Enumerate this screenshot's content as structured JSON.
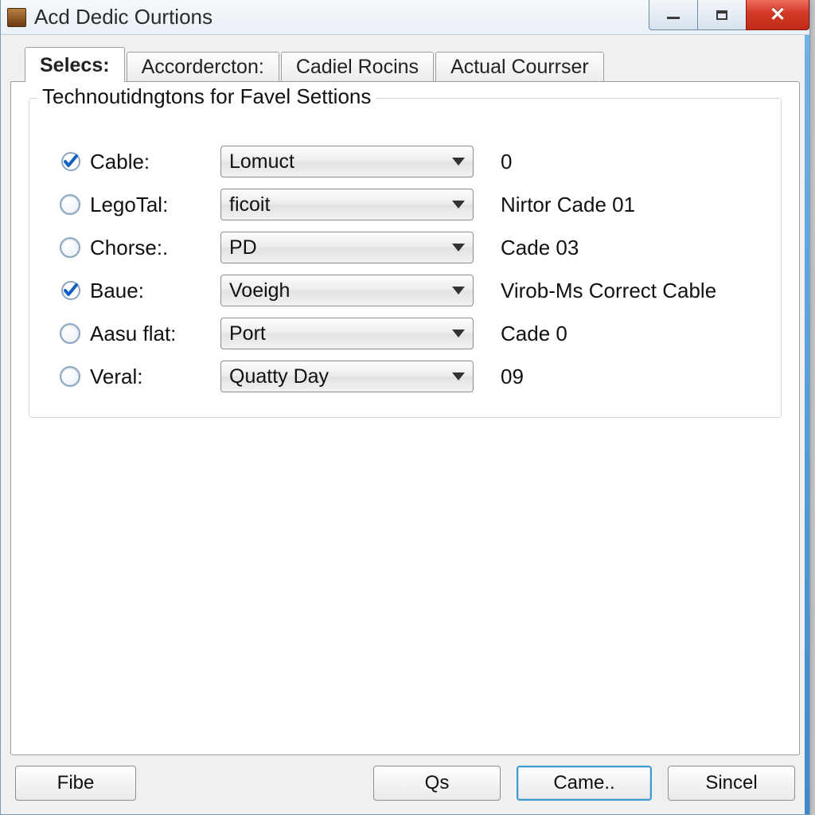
{
  "window": {
    "title": "Acd Dedic Ourtions"
  },
  "tabs": [
    {
      "label": "Selecs:",
      "active": true
    },
    {
      "label": "Accordercton:"
    },
    {
      "label": "Cadiel Rocins"
    },
    {
      "label": "Actual Courrser"
    }
  ],
  "group": {
    "title": "Technoutidngtons for Favel Settions",
    "rows": [
      {
        "checked": true,
        "label": "Cable:",
        "combo": "Lomuct",
        "desc": "0"
      },
      {
        "checked": false,
        "label": "LegoTal:",
        "combo": "ficoit",
        "desc": "Nirtor Cade 01"
      },
      {
        "checked": false,
        "label": "Chorse:.",
        "combo": "PD",
        "desc": "Cade 03"
      },
      {
        "checked": true,
        "label": "Baue:",
        "combo": "Voeigh",
        "desc": "Virob-Ms Correct Cable"
      },
      {
        "checked": false,
        "label": "Aasu flat:",
        "combo": "Port",
        "desc": "Cade 0"
      },
      {
        "checked": false,
        "label": "Veral:",
        "combo": "Quatty Day",
        "desc": "09"
      }
    ]
  },
  "buttons": {
    "left": "Fibe",
    "ok": "Qs",
    "default": "Came..",
    "cancel": "Sincel"
  }
}
